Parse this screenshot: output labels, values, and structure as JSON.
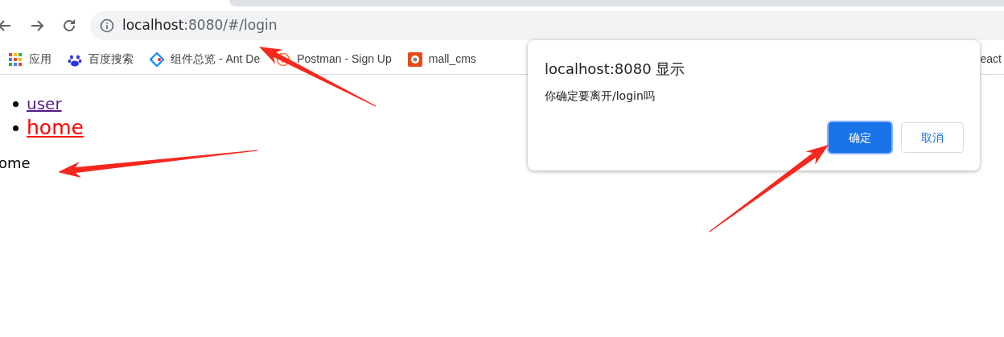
{
  "browser": {
    "nav_buttons": [
      {
        "kind": "back"
      },
      {
        "kind": "forward"
      },
      {
        "kind": "reload"
      }
    ],
    "address": {
      "host": "localhost",
      "path": ":8080/#/login"
    },
    "bookmarks": [
      {
        "kind": "apps",
        "label": "应用"
      },
      {
        "kind": "paw",
        "label": "百度搜索"
      },
      {
        "kind": "diamond",
        "label": "组件总览 - Ant De"
      },
      {
        "kind": "clock",
        "label": "Postman - Sign Up"
      },
      {
        "kind": "tile",
        "label": "mall_cms"
      }
    ],
    "bookmark_cut": "eact"
  },
  "page": {
    "links": [
      {
        "label": "user",
        "visited": true,
        "active": false
      },
      {
        "label": "home",
        "visited": false,
        "active": true
      }
    ],
    "view_text": "ome"
  },
  "dialog": {
    "title": "localhost:8080 显示",
    "message": "你确定要离开/login吗",
    "buttons": [
      {
        "label": "确定",
        "kind": "primary"
      },
      {
        "label": "取消",
        "kind": "secondary"
      }
    ]
  },
  "annotations": [
    {
      "kind": "arrow"
    },
    {
      "kind": "arrow"
    },
    {
      "kind": "arrow"
    }
  ]
}
